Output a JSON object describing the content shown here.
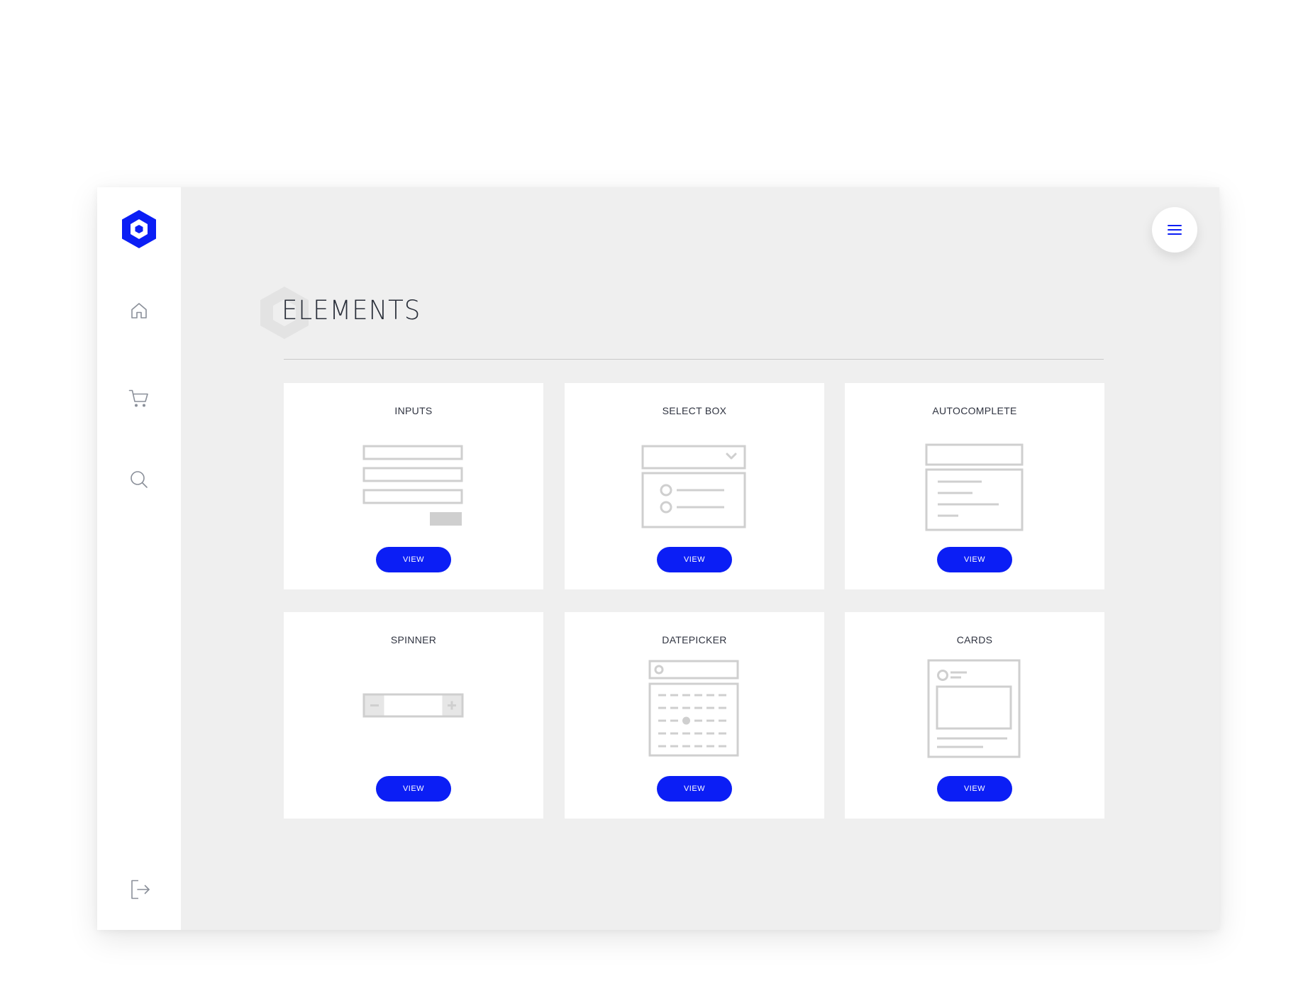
{
  "colors": {
    "accent": "#0b1ef5",
    "background": "#efefef",
    "card": "#ffffff",
    "wireframe": "#cfcfcf"
  },
  "sidebar": {
    "logo_icon": "hexagon-logo-icon",
    "items": [
      {
        "icon": "home-icon"
      },
      {
        "icon": "cart-icon"
      },
      {
        "icon": "search-icon"
      }
    ],
    "logout_icon": "logout-icon"
  },
  "header": {
    "menu_icon": "hamburger-menu-icon",
    "title": "ELEMENTS"
  },
  "cards": [
    {
      "title": "INPUTS",
      "button": "VIEW",
      "illustration": "inputs-wireframe-icon"
    },
    {
      "title": "SELECT BOX",
      "button": "VIEW",
      "illustration": "select-box-wireframe-icon"
    },
    {
      "title": "AUTOCOMPLETE",
      "button": "VIEW",
      "illustration": "autocomplete-wireframe-icon"
    },
    {
      "title": "SPINNER",
      "button": "VIEW",
      "illustration": "spinner-wireframe-icon"
    },
    {
      "title": "DATEPICKER",
      "button": "VIEW",
      "illustration": "datepicker-wireframe-icon"
    },
    {
      "title": "CARDS",
      "button": "VIEW",
      "illustration": "cards-wireframe-icon"
    }
  ]
}
